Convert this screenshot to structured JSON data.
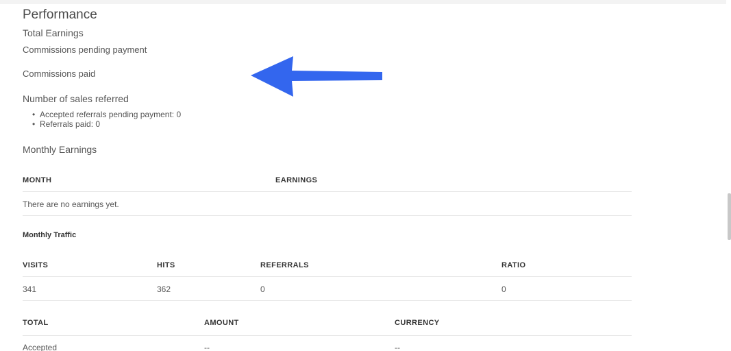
{
  "page": {
    "title": "Performance",
    "total_earnings": "Total Earnings",
    "commissions_pending": "Commissions pending payment",
    "commissions_paid": "Commissions paid",
    "sales_referred_heading": "Number of sales referred",
    "bullets": [
      "Accepted referrals pending payment: 0",
      "Referrals paid: 0"
    ],
    "monthly_earnings_heading": "Monthly Earnings"
  },
  "earnings_table": {
    "headers": [
      "MONTH",
      "EARNINGS"
    ],
    "empty_message": "There are no earnings yet."
  },
  "traffic": {
    "heading": "Monthly Traffic",
    "headers": [
      "VISITS",
      "HITS",
      "REFERRALS",
      "RATIO"
    ],
    "row": [
      "341",
      "362",
      "0",
      "0"
    ]
  },
  "totals_table": {
    "headers": [
      "TOTAL",
      "AMOUNT",
      "CURRENCY"
    ],
    "rows": [
      [
        "Accepted",
        "--",
        "--"
      ]
    ]
  },
  "annotation": {
    "arrow_color": "#3366ee",
    "arrow_direction": "left"
  },
  "icons": {
    "arrow": "left-arrow-icon"
  }
}
